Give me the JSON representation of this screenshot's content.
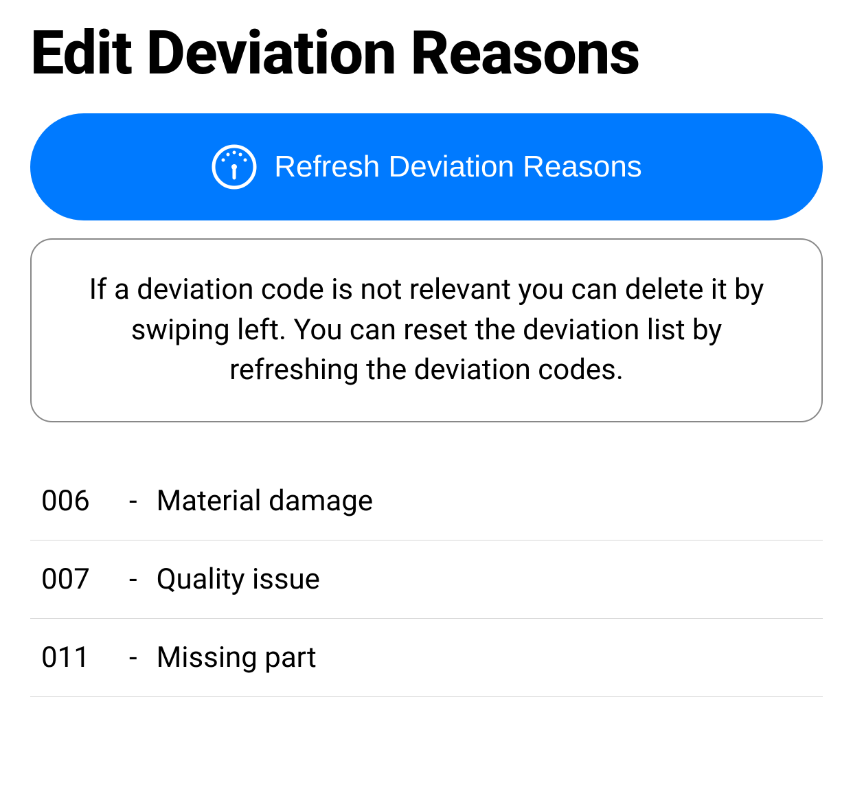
{
  "header": {
    "title": "Edit Deviation Reasons"
  },
  "refresh_button": {
    "label": "Refresh Deviation Reasons"
  },
  "info_box": {
    "text": "If a deviation code is not relevant you can delete it by swiping left. You can reset the deviation list by refreshing the deviation codes."
  },
  "list": {
    "separator": "-",
    "items": [
      {
        "code": "006",
        "label": "Material damage"
      },
      {
        "code": "007",
        "label": "Quality issue"
      },
      {
        "code": "011",
        "label": "Missing part"
      }
    ]
  }
}
